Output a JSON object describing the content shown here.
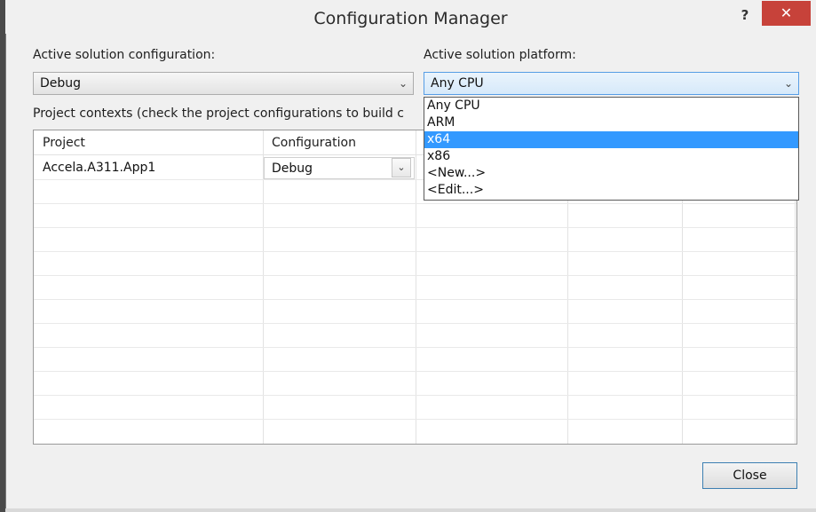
{
  "window": {
    "title": "Configuration Manager",
    "help_label": "?",
    "close_label": "✕"
  },
  "solution_configuration": {
    "label": "Active solution configuration:",
    "value": "Debug"
  },
  "solution_platform": {
    "label": "Active solution platform:",
    "value": "Any CPU",
    "options": [
      "Any CPU",
      "ARM",
      "x64",
      "x86",
      "<New...>",
      "<Edit...>"
    ],
    "highlighted": "x64"
  },
  "project_contexts": {
    "label": "Project contexts (check the project configurations to build c"
  },
  "grid": {
    "columns": [
      "Project",
      "Configuration"
    ],
    "rows": [
      {
        "project": "Accela.A311.App1",
        "configuration": "Debug"
      }
    ]
  },
  "icons": {
    "chevron": "chevron-down-icon"
  },
  "footer": {
    "close_button": "Close"
  },
  "colors": {
    "close_button_bg": "#c7423a",
    "selection": "#3399ff",
    "focus_border": "#569de5"
  }
}
